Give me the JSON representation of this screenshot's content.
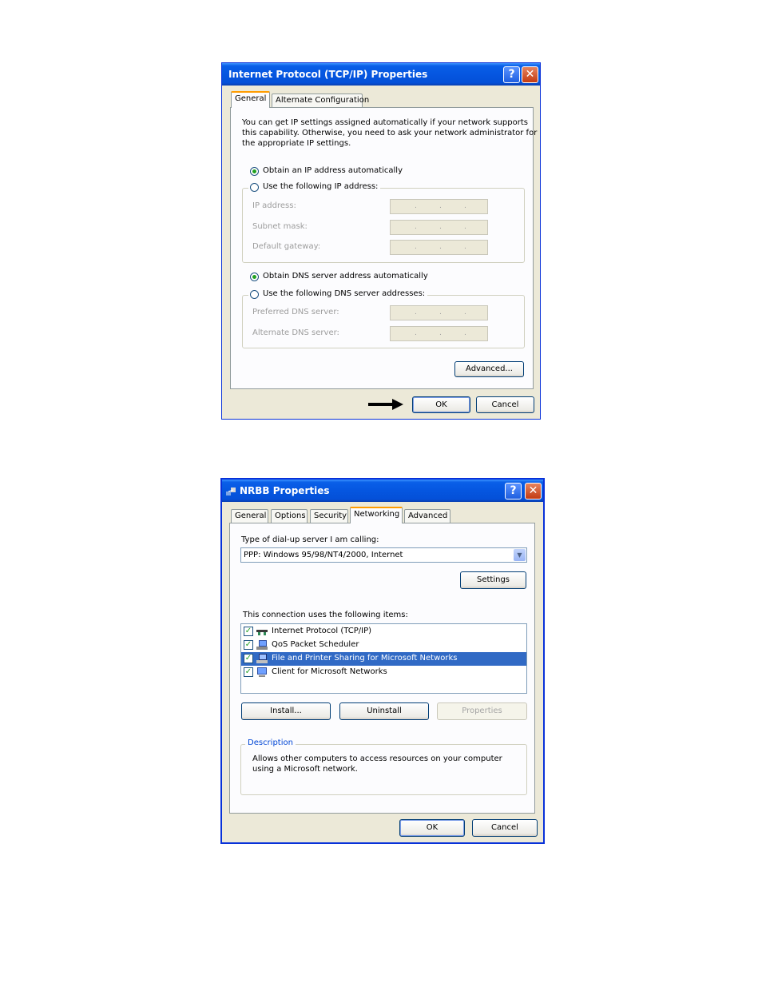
{
  "dialog1": {
    "title": "Internet Protocol (TCP/IP) Properties",
    "help_glyph": "?",
    "close_glyph": "✕",
    "tabs": [
      {
        "label": "General",
        "active": true
      },
      {
        "label": "Alternate Configuration",
        "active": false
      }
    ],
    "intro": [
      "You can get IP settings assigned automatically if your network supports",
      "this capability. Otherwise, you need to ask your network administrator for",
      "the appropriate IP settings."
    ],
    "radio_ip_auto": "Obtain an IP address automatically",
    "radio_ip_manual": "Use the following IP address:",
    "ip_fields": [
      {
        "label": "IP address:"
      },
      {
        "label": "Subnet mask:"
      },
      {
        "label": "Default gateway:"
      }
    ],
    "radio_dns_auto": "Obtain DNS server address automatically",
    "radio_dns_manual": "Use the following DNS server addresses:",
    "dns_fields": [
      {
        "label": "Preferred DNS server:"
      },
      {
        "label": "Alternate DNS server:"
      }
    ],
    "ip_dot": ".",
    "advanced_label": "Advanced...",
    "ok_label": "OK",
    "cancel_label": "Cancel"
  },
  "dialog2": {
    "title": "NRBB Properties",
    "help_glyph": "?",
    "close_glyph": "✕",
    "tabs": [
      {
        "label": "General",
        "active": false
      },
      {
        "label": "Options",
        "active": false
      },
      {
        "label": "Security",
        "active": false
      },
      {
        "label": "Networking",
        "active": true
      },
      {
        "label": "Advanced",
        "active": false
      }
    ],
    "server_type_label": "Type of dial-up server I am calling:",
    "server_type_value": "PPP: Windows 95/98/NT4/2000, Internet",
    "settings_label": "Settings",
    "items_label": "This connection uses the following items:",
    "items": [
      {
        "label": "Internet Protocol (TCP/IP)",
        "checked": true,
        "selected": false,
        "icon": "network-protocol-icon"
      },
      {
        "label": "QoS Packet Scheduler",
        "checked": true,
        "selected": false,
        "icon": "computer-service-icon"
      },
      {
        "label": "File and Printer Sharing for Microsoft Networks",
        "checked": true,
        "selected": true,
        "icon": "computer-service-icon"
      },
      {
        "label": "Client for Microsoft Networks",
        "checked": true,
        "selected": false,
        "icon": "network-client-icon"
      }
    ],
    "check_glyph": "✓",
    "install_label": "Install...",
    "uninstall_label": "Uninstall",
    "properties_label": "Properties",
    "description_title": "Description",
    "description_lines": [
      "Allows other computers to access resources on your computer",
      "using a Microsoft network."
    ],
    "ok_label": "OK",
    "cancel_label": "Cancel"
  },
  "colors": {
    "titlebar": "#0556e0",
    "dialog_face": "#ece9d8",
    "selection": "#316ac5",
    "active_tab_accent": "#ff9c00"
  }
}
